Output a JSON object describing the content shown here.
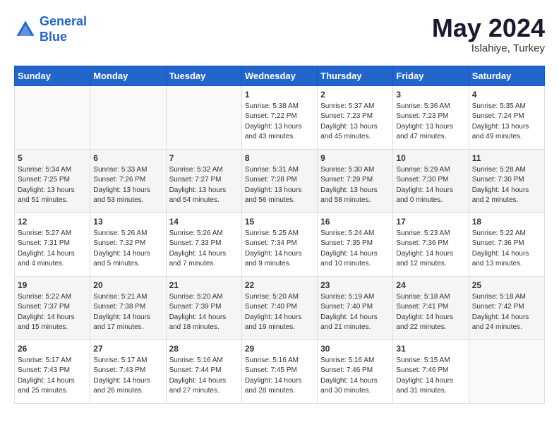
{
  "header": {
    "logo_line1": "General",
    "logo_line2": "Blue",
    "month_year": "May 2024",
    "location": "Islahiye, Turkey"
  },
  "weekdays": [
    "Sunday",
    "Monday",
    "Tuesday",
    "Wednesday",
    "Thursday",
    "Friday",
    "Saturday"
  ],
  "weeks": [
    [
      {
        "day": "",
        "info": ""
      },
      {
        "day": "",
        "info": ""
      },
      {
        "day": "",
        "info": ""
      },
      {
        "day": "1",
        "info": "Sunrise: 5:38 AM\nSunset: 7:22 PM\nDaylight: 13 hours\nand 43 minutes."
      },
      {
        "day": "2",
        "info": "Sunrise: 5:37 AM\nSunset: 7:23 PM\nDaylight: 13 hours\nand 45 minutes."
      },
      {
        "day": "3",
        "info": "Sunrise: 5:36 AM\nSunset: 7:23 PM\nDaylight: 13 hours\nand 47 minutes."
      },
      {
        "day": "4",
        "info": "Sunrise: 5:35 AM\nSunset: 7:24 PM\nDaylight: 13 hours\nand 49 minutes."
      }
    ],
    [
      {
        "day": "5",
        "info": "Sunrise: 5:34 AM\nSunset: 7:25 PM\nDaylight: 13 hours\nand 51 minutes."
      },
      {
        "day": "6",
        "info": "Sunrise: 5:33 AM\nSunset: 7:26 PM\nDaylight: 13 hours\nand 53 minutes."
      },
      {
        "day": "7",
        "info": "Sunrise: 5:32 AM\nSunset: 7:27 PM\nDaylight: 13 hours\nand 54 minutes."
      },
      {
        "day": "8",
        "info": "Sunrise: 5:31 AM\nSunset: 7:28 PM\nDaylight: 13 hours\nand 56 minutes."
      },
      {
        "day": "9",
        "info": "Sunrise: 5:30 AM\nSunset: 7:29 PM\nDaylight: 13 hours\nand 58 minutes."
      },
      {
        "day": "10",
        "info": "Sunrise: 5:29 AM\nSunset: 7:30 PM\nDaylight: 14 hours\nand 0 minutes."
      },
      {
        "day": "11",
        "info": "Sunrise: 5:28 AM\nSunset: 7:30 PM\nDaylight: 14 hours\nand 2 minutes."
      }
    ],
    [
      {
        "day": "12",
        "info": "Sunrise: 5:27 AM\nSunset: 7:31 PM\nDaylight: 14 hours\nand 4 minutes."
      },
      {
        "day": "13",
        "info": "Sunrise: 5:26 AM\nSunset: 7:32 PM\nDaylight: 14 hours\nand 5 minutes."
      },
      {
        "day": "14",
        "info": "Sunrise: 5:26 AM\nSunset: 7:33 PM\nDaylight: 14 hours\nand 7 minutes."
      },
      {
        "day": "15",
        "info": "Sunrise: 5:25 AM\nSunset: 7:34 PM\nDaylight: 14 hours\nand 9 minutes."
      },
      {
        "day": "16",
        "info": "Sunrise: 5:24 AM\nSunset: 7:35 PM\nDaylight: 14 hours\nand 10 minutes."
      },
      {
        "day": "17",
        "info": "Sunrise: 5:23 AM\nSunset: 7:36 PM\nDaylight: 14 hours\nand 12 minutes."
      },
      {
        "day": "18",
        "info": "Sunrise: 5:22 AM\nSunset: 7:36 PM\nDaylight: 14 hours\nand 13 minutes."
      }
    ],
    [
      {
        "day": "19",
        "info": "Sunrise: 5:22 AM\nSunset: 7:37 PM\nDaylight: 14 hours\nand 15 minutes."
      },
      {
        "day": "20",
        "info": "Sunrise: 5:21 AM\nSunset: 7:38 PM\nDaylight: 14 hours\nand 17 minutes."
      },
      {
        "day": "21",
        "info": "Sunrise: 5:20 AM\nSunset: 7:39 PM\nDaylight: 14 hours\nand 18 minutes."
      },
      {
        "day": "22",
        "info": "Sunrise: 5:20 AM\nSunset: 7:40 PM\nDaylight: 14 hours\nand 19 minutes."
      },
      {
        "day": "23",
        "info": "Sunrise: 5:19 AM\nSunset: 7:40 PM\nDaylight: 14 hours\nand 21 minutes."
      },
      {
        "day": "24",
        "info": "Sunrise: 5:18 AM\nSunset: 7:41 PM\nDaylight: 14 hours\nand 22 minutes."
      },
      {
        "day": "25",
        "info": "Sunrise: 5:18 AM\nSunset: 7:42 PM\nDaylight: 14 hours\nand 24 minutes."
      }
    ],
    [
      {
        "day": "26",
        "info": "Sunrise: 5:17 AM\nSunset: 7:43 PM\nDaylight: 14 hours\nand 25 minutes."
      },
      {
        "day": "27",
        "info": "Sunrise: 5:17 AM\nSunset: 7:43 PM\nDaylight: 14 hours\nand 26 minutes."
      },
      {
        "day": "28",
        "info": "Sunrise: 5:16 AM\nSunset: 7:44 PM\nDaylight: 14 hours\nand 27 minutes."
      },
      {
        "day": "29",
        "info": "Sunrise: 5:16 AM\nSunset: 7:45 PM\nDaylight: 14 hours\nand 28 minutes."
      },
      {
        "day": "30",
        "info": "Sunrise: 5:16 AM\nSunset: 7:46 PM\nDaylight: 14 hours\nand 30 minutes."
      },
      {
        "day": "31",
        "info": "Sunrise: 5:15 AM\nSunset: 7:46 PM\nDaylight: 14 hours\nand 31 minutes."
      },
      {
        "day": "",
        "info": ""
      }
    ]
  ]
}
